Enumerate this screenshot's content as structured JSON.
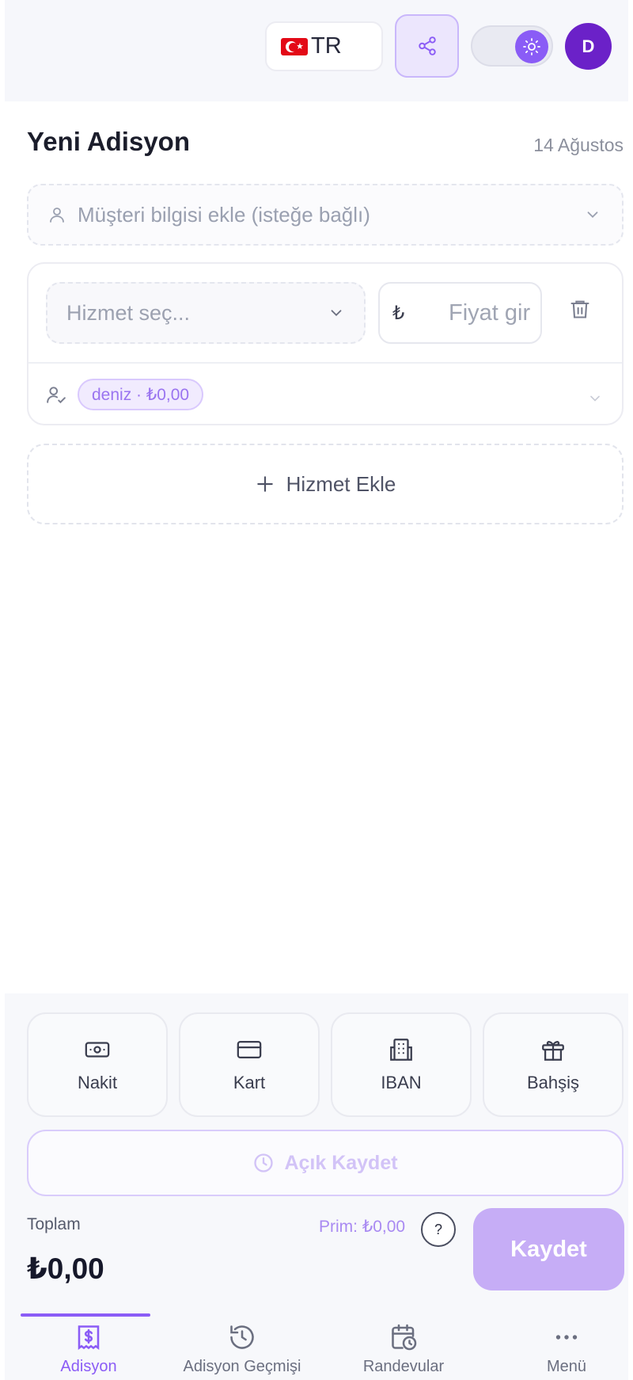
{
  "header": {
    "language": "TR",
    "avatar_initial": "D"
  },
  "page": {
    "title": "Yeni Adisyon",
    "date": "14 Ağustos"
  },
  "customer": {
    "placeholder": "Müşteri bilgisi ekle (isteğe bağlı)"
  },
  "service_item": {
    "service_placeholder": "Hizmet seç...",
    "currency_symbol": "₺",
    "price_placeholder": "Fiyat gir",
    "staff_chip": "deniz · ₺0,00"
  },
  "add_service_label": "Hizmet Ekle",
  "payment_methods": [
    {
      "label": "Nakit",
      "icon": "cash-icon"
    },
    {
      "label": "Kart",
      "icon": "credit-card-icon"
    },
    {
      "label": "IBAN",
      "icon": "bank-icon"
    },
    {
      "label": "Bahşiş",
      "icon": "gift-icon"
    }
  ],
  "open_save_label": "Açık Kaydet",
  "total": {
    "label": "Toplam",
    "value": "₺0,00",
    "prim": "Prim: ₺0,00",
    "help": "?"
  },
  "save_label": "Kaydet",
  "nav": [
    {
      "label": "Adisyon",
      "icon": "receipt-icon",
      "active": true
    },
    {
      "label": "Adisyon Geçmişi",
      "icon": "history-icon",
      "active": false
    },
    {
      "label": "Randevular",
      "icon": "calendar-clock-icon",
      "active": false
    },
    {
      "label": "Menü",
      "icon": "more-icon",
      "active": false
    }
  ],
  "colors": {
    "accent": "#8b5cf6",
    "accent_light": "#ece6fd",
    "save_button": "#c6adf6",
    "avatar": "#6b21c8"
  }
}
